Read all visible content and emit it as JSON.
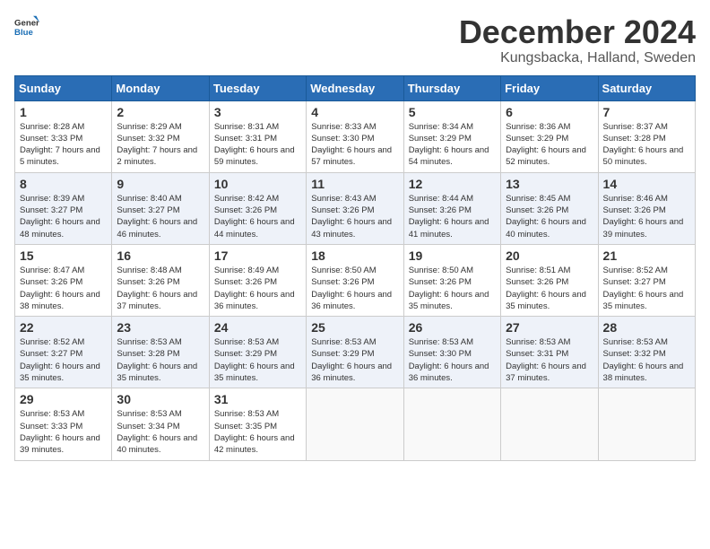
{
  "header": {
    "logo_general": "General",
    "logo_blue": "Blue",
    "month_title": "December 2024",
    "location": "Kungsbacka, Halland, Sweden"
  },
  "days_of_week": [
    "Sunday",
    "Monday",
    "Tuesday",
    "Wednesday",
    "Thursday",
    "Friday",
    "Saturday"
  ],
  "weeks": [
    [
      {
        "day": "1",
        "sunrise": "Sunrise: 8:28 AM",
        "sunset": "Sunset: 3:33 PM",
        "daylight": "Daylight: 7 hours and 5 minutes."
      },
      {
        "day": "2",
        "sunrise": "Sunrise: 8:29 AM",
        "sunset": "Sunset: 3:32 PM",
        "daylight": "Daylight: 7 hours and 2 minutes."
      },
      {
        "day": "3",
        "sunrise": "Sunrise: 8:31 AM",
        "sunset": "Sunset: 3:31 PM",
        "daylight": "Daylight: 6 hours and 59 minutes."
      },
      {
        "day": "4",
        "sunrise": "Sunrise: 8:33 AM",
        "sunset": "Sunset: 3:30 PM",
        "daylight": "Daylight: 6 hours and 57 minutes."
      },
      {
        "day": "5",
        "sunrise": "Sunrise: 8:34 AM",
        "sunset": "Sunset: 3:29 PM",
        "daylight": "Daylight: 6 hours and 54 minutes."
      },
      {
        "day": "6",
        "sunrise": "Sunrise: 8:36 AM",
        "sunset": "Sunset: 3:29 PM",
        "daylight": "Daylight: 6 hours and 52 minutes."
      },
      {
        "day": "7",
        "sunrise": "Sunrise: 8:37 AM",
        "sunset": "Sunset: 3:28 PM",
        "daylight": "Daylight: 6 hours and 50 minutes."
      }
    ],
    [
      {
        "day": "8",
        "sunrise": "Sunrise: 8:39 AM",
        "sunset": "Sunset: 3:27 PM",
        "daylight": "Daylight: 6 hours and 48 minutes."
      },
      {
        "day": "9",
        "sunrise": "Sunrise: 8:40 AM",
        "sunset": "Sunset: 3:27 PM",
        "daylight": "Daylight: 6 hours and 46 minutes."
      },
      {
        "day": "10",
        "sunrise": "Sunrise: 8:42 AM",
        "sunset": "Sunset: 3:26 PM",
        "daylight": "Daylight: 6 hours and 44 minutes."
      },
      {
        "day": "11",
        "sunrise": "Sunrise: 8:43 AM",
        "sunset": "Sunset: 3:26 PM",
        "daylight": "Daylight: 6 hours and 43 minutes."
      },
      {
        "day": "12",
        "sunrise": "Sunrise: 8:44 AM",
        "sunset": "Sunset: 3:26 PM",
        "daylight": "Daylight: 6 hours and 41 minutes."
      },
      {
        "day": "13",
        "sunrise": "Sunrise: 8:45 AM",
        "sunset": "Sunset: 3:26 PM",
        "daylight": "Daylight: 6 hours and 40 minutes."
      },
      {
        "day": "14",
        "sunrise": "Sunrise: 8:46 AM",
        "sunset": "Sunset: 3:26 PM",
        "daylight": "Daylight: 6 hours and 39 minutes."
      }
    ],
    [
      {
        "day": "15",
        "sunrise": "Sunrise: 8:47 AM",
        "sunset": "Sunset: 3:26 PM",
        "daylight": "Daylight: 6 hours and 38 minutes."
      },
      {
        "day": "16",
        "sunrise": "Sunrise: 8:48 AM",
        "sunset": "Sunset: 3:26 PM",
        "daylight": "Daylight: 6 hours and 37 minutes."
      },
      {
        "day": "17",
        "sunrise": "Sunrise: 8:49 AM",
        "sunset": "Sunset: 3:26 PM",
        "daylight": "Daylight: 6 hours and 36 minutes."
      },
      {
        "day": "18",
        "sunrise": "Sunrise: 8:50 AM",
        "sunset": "Sunset: 3:26 PM",
        "daylight": "Daylight: 6 hours and 36 minutes."
      },
      {
        "day": "19",
        "sunrise": "Sunrise: 8:50 AM",
        "sunset": "Sunset: 3:26 PM",
        "daylight": "Daylight: 6 hours and 35 minutes."
      },
      {
        "day": "20",
        "sunrise": "Sunrise: 8:51 AM",
        "sunset": "Sunset: 3:26 PM",
        "daylight": "Daylight: 6 hours and 35 minutes."
      },
      {
        "day": "21",
        "sunrise": "Sunrise: 8:52 AM",
        "sunset": "Sunset: 3:27 PM",
        "daylight": "Daylight: 6 hours and 35 minutes."
      }
    ],
    [
      {
        "day": "22",
        "sunrise": "Sunrise: 8:52 AM",
        "sunset": "Sunset: 3:27 PM",
        "daylight": "Daylight: 6 hours and 35 minutes."
      },
      {
        "day": "23",
        "sunrise": "Sunrise: 8:53 AM",
        "sunset": "Sunset: 3:28 PM",
        "daylight": "Daylight: 6 hours and 35 minutes."
      },
      {
        "day": "24",
        "sunrise": "Sunrise: 8:53 AM",
        "sunset": "Sunset: 3:29 PM",
        "daylight": "Daylight: 6 hours and 35 minutes."
      },
      {
        "day": "25",
        "sunrise": "Sunrise: 8:53 AM",
        "sunset": "Sunset: 3:29 PM",
        "daylight": "Daylight: 6 hours and 36 minutes."
      },
      {
        "day": "26",
        "sunrise": "Sunrise: 8:53 AM",
        "sunset": "Sunset: 3:30 PM",
        "daylight": "Daylight: 6 hours and 36 minutes."
      },
      {
        "day": "27",
        "sunrise": "Sunrise: 8:53 AM",
        "sunset": "Sunset: 3:31 PM",
        "daylight": "Daylight: 6 hours and 37 minutes."
      },
      {
        "day": "28",
        "sunrise": "Sunrise: 8:53 AM",
        "sunset": "Sunset: 3:32 PM",
        "daylight": "Daylight: 6 hours and 38 minutes."
      }
    ],
    [
      {
        "day": "29",
        "sunrise": "Sunrise: 8:53 AM",
        "sunset": "Sunset: 3:33 PM",
        "daylight": "Daylight: 6 hours and 39 minutes."
      },
      {
        "day": "30",
        "sunrise": "Sunrise: 8:53 AM",
        "sunset": "Sunset: 3:34 PM",
        "daylight": "Daylight: 6 hours and 40 minutes."
      },
      {
        "day": "31",
        "sunrise": "Sunrise: 8:53 AM",
        "sunset": "Sunset: 3:35 PM",
        "daylight": "Daylight: 6 hours and 42 minutes."
      },
      {
        "day": "",
        "sunrise": "",
        "sunset": "",
        "daylight": ""
      },
      {
        "day": "",
        "sunrise": "",
        "sunset": "",
        "daylight": ""
      },
      {
        "day": "",
        "sunrise": "",
        "sunset": "",
        "daylight": ""
      },
      {
        "day": "",
        "sunrise": "",
        "sunset": "",
        "daylight": ""
      }
    ]
  ]
}
